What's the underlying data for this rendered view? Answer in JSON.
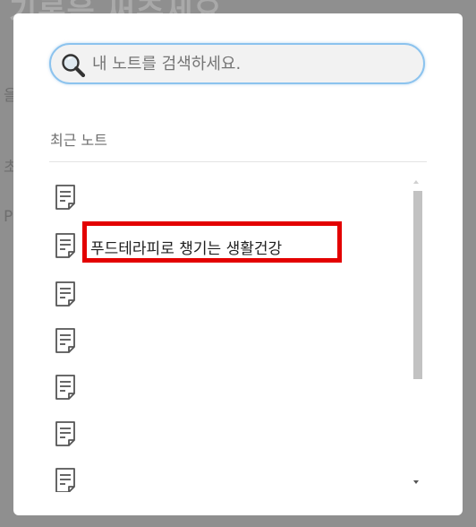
{
  "background": {
    "heading": "기록을 써주세요",
    "side_fragments": [
      "을",
      "초",
      "P"
    ]
  },
  "search": {
    "placeholder": "내 노트를 검색하세요.",
    "icon": "search-icon"
  },
  "recent": {
    "section_title": "최근 노트",
    "items": [
      {
        "title": ""
      },
      {
        "title": "푸드테라피로 챙기는 생활건강"
      },
      {
        "title": ""
      },
      {
        "title": ""
      },
      {
        "title": ""
      },
      {
        "title": ""
      },
      {
        "title": ""
      }
    ]
  },
  "colors": {
    "highlight": "#e30000",
    "search_border": "#8cc3ee"
  }
}
